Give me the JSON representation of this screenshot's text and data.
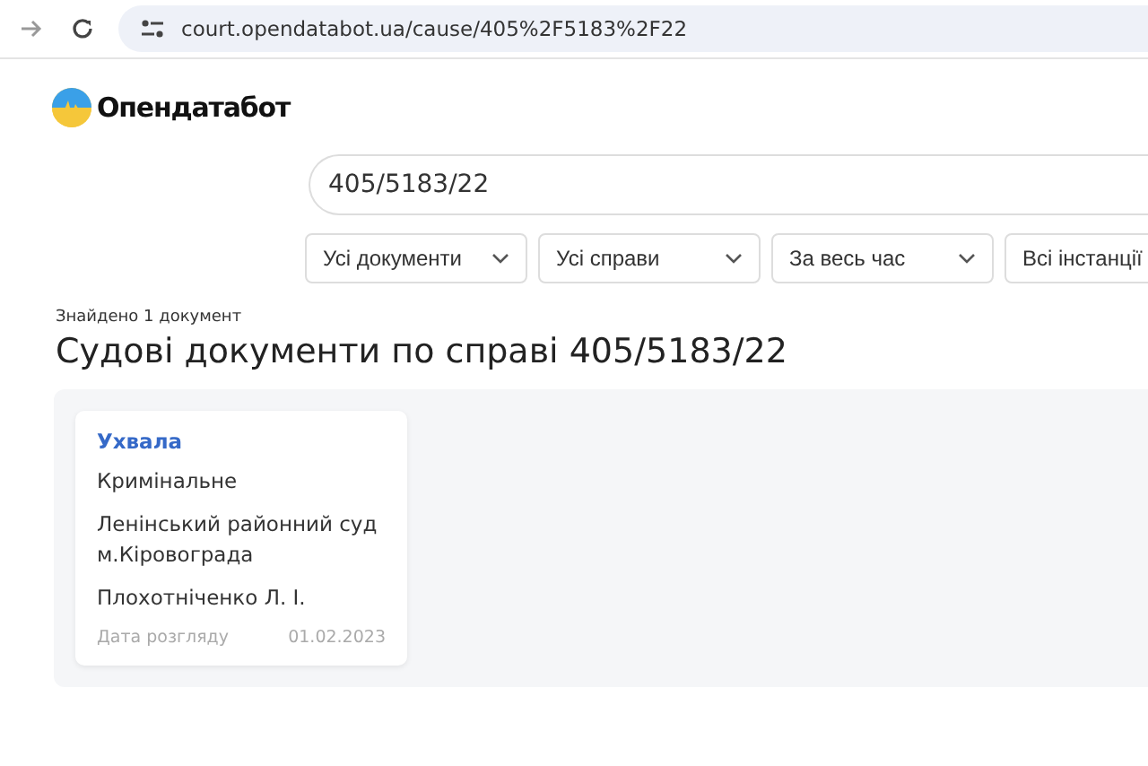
{
  "browser": {
    "url": "court.opendatabot.ua/cause/405%2F5183%2F22"
  },
  "logo": {
    "text": "Опендатабот"
  },
  "search": {
    "value": "405/5183/22"
  },
  "filters": [
    {
      "label": "Усі документи"
    },
    {
      "label": "Усі справи"
    },
    {
      "label": "За весь час"
    },
    {
      "label": "Всі інстанції"
    }
  ],
  "results": {
    "count_text": "Знайдено 1 документ",
    "heading": "Судові документи по справі 405/5183/22",
    "documents": [
      {
        "type": "Ухвала",
        "category": "Кримінальне",
        "court": "Ленінський районний суд м.Кіровограда",
        "judge": "Плохотніченко Л. І.",
        "date_label": "Дата розгляду",
        "date": "01.02.2023"
      }
    ]
  }
}
